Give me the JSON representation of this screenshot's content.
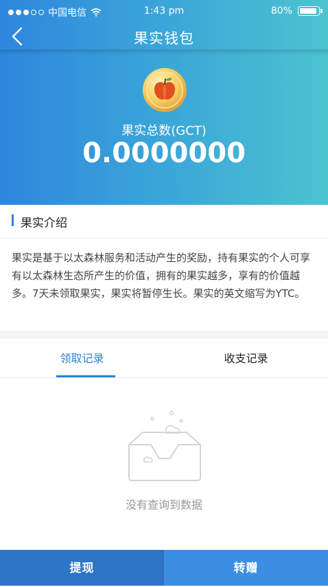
{
  "status_bar": {
    "carrier": "中国电信",
    "time": "1:43 pm",
    "battery": "80%",
    "battery_level": 0.8,
    "signal_icon": "signal-dots-icon",
    "wifi_icon": "wifi-icon"
  },
  "nav": {
    "title": "果实钱包",
    "back_icon": "chevron-left-icon"
  },
  "wallet": {
    "coin_icon": "apple-coin-icon",
    "total_label": "果实总数(GCT)",
    "total_value": "0.0000000"
  },
  "intro": {
    "title": "果实介绍",
    "text": "果实是基于以太森林服务和活动产生的奖励，持有果实的个人可享有以太森林生态所产生的价值，拥有的果实越多，享有的价值越多。7天未领取果实，果实将暂停生长。果实的英文缩写为YTC。"
  },
  "tabs": [
    {
      "label": "领取记录",
      "active": true
    },
    {
      "label": "收支记录",
      "active": false
    }
  ],
  "empty_state": {
    "icon": "empty-box-icon",
    "text": "没有查询到数据"
  },
  "actions": {
    "withdraw": "提现",
    "transfer": "转赠"
  },
  "colors": {
    "accent": "#2f80d8",
    "gradient_start": "#2e86dd",
    "gradient_end": "#4bc3cf",
    "withdraw_bg": "#2d74c7",
    "transfer_bg": "#3c8ee2"
  }
}
